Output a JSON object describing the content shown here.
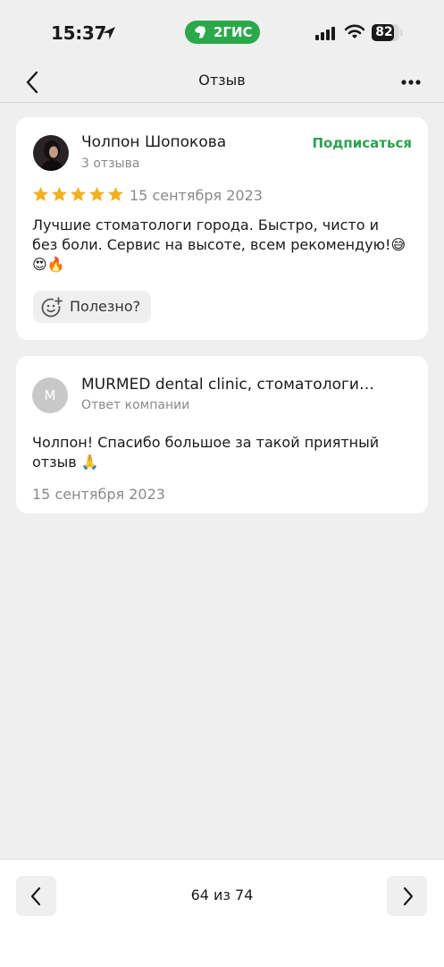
{
  "status_bar": {
    "time": "15:37",
    "app_badge": "2ГИС",
    "battery": "82",
    "battery_level": 0.82
  },
  "nav": {
    "title": "Отзыв"
  },
  "review": {
    "author": "Чолпон Шопокова",
    "author_reviews": "3 отзыва",
    "subscribe_label": "Подписаться",
    "rating": 5,
    "date": "15 сентября 2023",
    "text": "Лучшие стоматологи города. Быстро, чисто и без боли. Сервис на высоте, всем рекомендую!😅😍🔥",
    "useful_label": "Полезно?"
  },
  "reply": {
    "avatar_letter": "M",
    "company": "MURMED dental clinic, стоматологи…",
    "label": "Ответ компании",
    "text": "Чолпон! Спасибо большое за такой приятный отзыв 🙏",
    "date": "15 сентября 2023"
  },
  "pager": {
    "text": "64 из 74"
  },
  "colors": {
    "accent_green": "#2ba24c",
    "badge_green": "#2aa84a",
    "star_gold": "#f2b01e"
  }
}
